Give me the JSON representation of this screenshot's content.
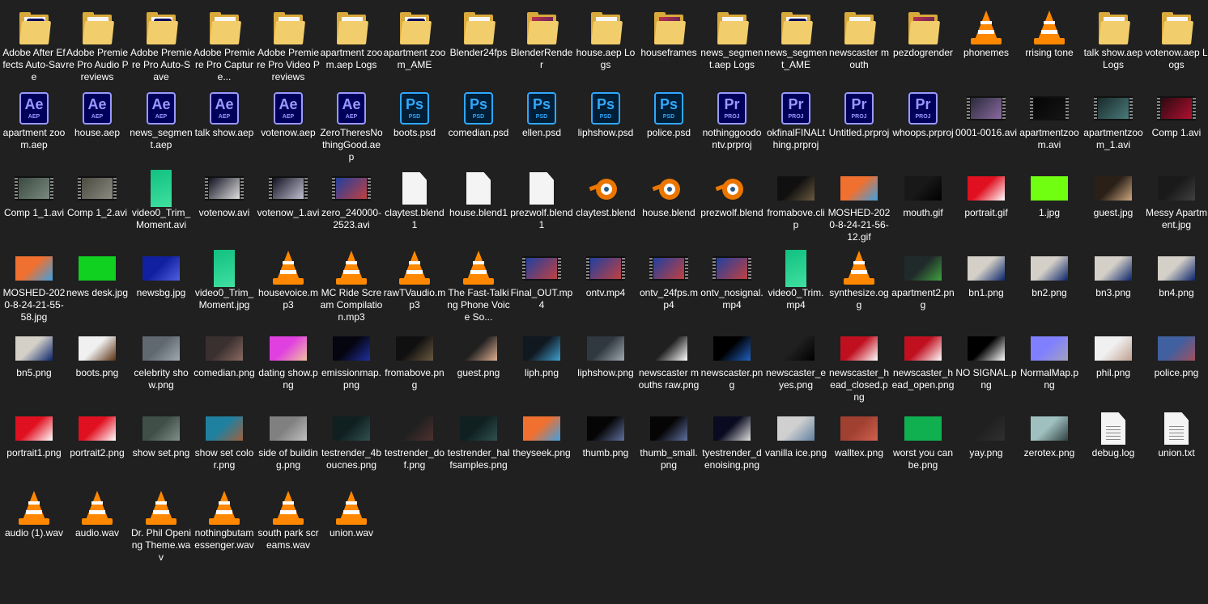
{
  "items": [
    {
      "label": "Adobe After Effects Auto-Save",
      "icon": "folder-ae-icon",
      "kind": "folder",
      "badge": "Ae"
    },
    {
      "label": "Adobe Premiere Pro Audio Previews",
      "icon": "folder-icon",
      "kind": "folder"
    },
    {
      "label": "Adobe Premiere Pro Auto-Save",
      "icon": "folder-pr-icon",
      "kind": "folder",
      "badge": "Pr"
    },
    {
      "label": "Adobe Premiere Pro Capture...",
      "icon": "folder-icon",
      "kind": "folder"
    },
    {
      "label": "Adobe Premiere Pro Video Previews",
      "icon": "folder-icon",
      "kind": "folder"
    },
    {
      "label": "apartment zoom.aep Logs",
      "icon": "folder-icon",
      "kind": "folder"
    },
    {
      "label": "apartment zoom_AME",
      "icon": "folder-ae-icon",
      "kind": "folder",
      "badge": "Ae"
    },
    {
      "label": "Blender24fps",
      "icon": "folder-icon",
      "kind": "folder"
    },
    {
      "label": "BlenderRender",
      "icon": "folder-images-icon",
      "kind": "folder-img"
    },
    {
      "label": "house.aep Logs",
      "icon": "folder-icon",
      "kind": "folder"
    },
    {
      "label": "houseframes",
      "icon": "folder-images-icon",
      "kind": "folder-img"
    },
    {
      "label": "news_segment.aep Logs",
      "icon": "folder-icon",
      "kind": "folder"
    },
    {
      "label": "news_segment_AME",
      "icon": "folder-ae-icon",
      "kind": "folder",
      "badge": "Ae"
    },
    {
      "label": "newscaster mouth",
      "icon": "folder-icon",
      "kind": "folder"
    },
    {
      "label": "pezdogrender",
      "icon": "folder-images-icon",
      "kind": "folder-img"
    },
    {
      "label": "phonemes",
      "icon": "folder-vlc-icon",
      "kind": "vlc"
    },
    {
      "label": "rrising tone",
      "icon": "folder-vlc-icon",
      "kind": "vlc"
    },
    {
      "label": "talk show.aep Logs",
      "icon": "folder-icon",
      "kind": "folder"
    },
    {
      "label": "votenow.aep Logs",
      "icon": "folder-icon",
      "kind": "folder"
    },
    {
      "label": "apartment zoom.aep",
      "icon": "after-effects-file-icon",
      "kind": "ae",
      "ext": "AEP"
    },
    {
      "label": "house.aep",
      "icon": "after-effects-file-icon",
      "kind": "ae",
      "ext": "AEP"
    },
    {
      "label": "news_segment.aep",
      "icon": "after-effects-file-icon",
      "kind": "ae",
      "ext": "AEP"
    },
    {
      "label": "talk show.aep",
      "icon": "after-effects-file-icon",
      "kind": "ae",
      "ext": "AEP"
    },
    {
      "label": "votenow.aep",
      "icon": "after-effects-file-icon",
      "kind": "ae",
      "ext": "AEP"
    },
    {
      "label": "ZeroTheresNothingGood.aep",
      "icon": "after-effects-file-icon",
      "kind": "ae",
      "ext": "AEP"
    },
    {
      "label": "boots.psd",
      "icon": "photoshop-file-icon",
      "kind": "ps",
      "ext": "PSD"
    },
    {
      "label": "comedian.psd",
      "icon": "photoshop-file-icon",
      "kind": "ps",
      "ext": "PSD"
    },
    {
      "label": "ellen.psd",
      "icon": "photoshop-file-icon",
      "kind": "ps",
      "ext": "PSD"
    },
    {
      "label": "liphshow.psd",
      "icon": "photoshop-file-icon",
      "kind": "ps",
      "ext": "PSD"
    },
    {
      "label": "police.psd",
      "icon": "photoshop-file-icon",
      "kind": "ps",
      "ext": "PSD"
    },
    {
      "label": "nothinggoodontv.prproj",
      "icon": "premiere-file-icon",
      "kind": "pr",
      "ext": "PROJ"
    },
    {
      "label": "okfinalFINALthing.prproj",
      "icon": "premiere-file-icon",
      "kind": "pr",
      "ext": "PROJ"
    },
    {
      "label": "Untitled.prproj",
      "icon": "premiere-file-icon",
      "kind": "pr",
      "ext": "PROJ"
    },
    {
      "label": "whoops.prproj",
      "icon": "premiere-file-icon",
      "kind": "pr",
      "ext": "PROJ"
    },
    {
      "label": "0001-0016.avi",
      "icon": "video-thumbnail-icon",
      "kind": "film",
      "c1": "#2a2a3a",
      "c2": "#8a6aa0"
    },
    {
      "label": "apartmentzoom.avi",
      "icon": "video-thumbnail-icon",
      "kind": "film",
      "c1": "#050505",
      "c2": "#151515"
    },
    {
      "label": "apartmentzoom_1.avi",
      "icon": "video-thumbnail-icon",
      "kind": "film",
      "c1": "#1a2a2a",
      "c2": "#4a7a7a"
    },
    {
      "label": "Comp 1.avi",
      "icon": "video-thumbnail-icon",
      "kind": "film",
      "c1": "#2a0a10",
      "c2": "#b01030"
    },
    {
      "label": "Comp 1_1.avi",
      "icon": "video-thumbnail-icon",
      "kind": "film",
      "c1": "#3a4a40",
      "c2": "#7a8a80"
    },
    {
      "label": "Comp 1_2.avi",
      "icon": "video-thumbnail-icon",
      "kind": "film",
      "c1": "#4a4a40",
      "c2": "#8a8a80"
    },
    {
      "label": "video0_Trim_Moment.avi",
      "icon": "video-thumbnail-icon",
      "kind": "tall",
      "c1": "#10c080",
      "c2": "#40e0a0"
    },
    {
      "label": "votenow.avi",
      "icon": "video-thumbnail-icon",
      "kind": "film",
      "c1": "#101020",
      "c2": "#e0e0e0"
    },
    {
      "label": "votenow_1.avi",
      "icon": "video-thumbnail-icon",
      "kind": "film",
      "c1": "#101020",
      "c2": "#c0c0d0"
    },
    {
      "label": "zero_240000-2523.avi",
      "icon": "video-thumbnail-icon",
      "kind": "film",
      "c1": "#2040a0",
      "c2": "#c04040"
    },
    {
      "label": "claytest.blend1",
      "icon": "blank-file-icon",
      "kind": "doc"
    },
    {
      "label": "house.blend1",
      "icon": "blank-file-icon",
      "kind": "doc"
    },
    {
      "label": "prezwolf.blend1",
      "icon": "blank-file-icon",
      "kind": "doc"
    },
    {
      "label": "claytest.blend",
      "icon": "blender-icon",
      "kind": "blender"
    },
    {
      "label": "house.blend",
      "icon": "blender-icon",
      "kind": "blender"
    },
    {
      "label": "prezwolf.blend",
      "icon": "blender-icon",
      "kind": "blender"
    },
    {
      "label": "fromabove.clip",
      "icon": "clip-file-icon",
      "kind": "img",
      "c1": "#101010",
      "c2": "#6a5a40"
    },
    {
      "label": "MOSHED-2020-8-24-21-56-12.gif",
      "icon": "image-thumbnail-icon",
      "kind": "img",
      "c1": "#f07030",
      "c2": "#40a0e0"
    },
    {
      "label": "mouth.gif",
      "icon": "image-thumbnail-icon",
      "kind": "img",
      "c1": "#181818",
      "c2": "#000000"
    },
    {
      "label": "portrait.gif",
      "icon": "image-thumbnail-icon",
      "kind": "img",
      "c1": "#e01020",
      "c2": "#ffffff"
    },
    {
      "label": "1.jpg",
      "icon": "image-thumbnail-icon",
      "kind": "img",
      "c1": "#70ff10",
      "c2": "#70ff10"
    },
    {
      "label": "guest.jpg",
      "icon": "image-thumbnail-icon",
      "kind": "img",
      "c1": "#2a2018",
      "c2": "#d0a880"
    },
    {
      "label": "Messy Apartment.jpg",
      "icon": "image-thumbnail-icon",
      "kind": "img",
      "c1": "#1a1a1a",
      "c2": "#404040"
    },
    {
      "label": "MOSHED-2020-8-24-21-55-58.jpg",
      "icon": "image-thumbnail-icon",
      "kind": "img",
      "c1": "#f07030",
      "c2": "#40a0e0"
    },
    {
      "label": "news desk.jpg",
      "icon": "image-thumbnail-icon",
      "kind": "img",
      "c1": "#10d020",
      "c2": "#10d020"
    },
    {
      "label": "newsbg.jpg",
      "icon": "image-thumbnail-icon",
      "kind": "img",
      "c1": "#1020a0",
      "c2": "#5060e0"
    },
    {
      "label": "video0_Trim_Moment.jpg",
      "icon": "image-thumbnail-icon",
      "kind": "tall",
      "c1": "#10c080",
      "c2": "#40e0a0"
    },
    {
      "label": "housevoice.mp3",
      "icon": "vlc-icon",
      "kind": "vlc"
    },
    {
      "label": "MC Ride Scream Compilation.mp3",
      "icon": "vlc-icon",
      "kind": "vlc"
    },
    {
      "label": "rawTVaudio.mp3",
      "icon": "vlc-icon",
      "kind": "vlc"
    },
    {
      "label": "The Fast-Talking Phone Voice So...",
      "icon": "vlc-icon",
      "kind": "vlc"
    },
    {
      "label": "Final_OUT.mp4",
      "icon": "video-thumbnail-icon",
      "kind": "film",
      "c1": "#2040a0",
      "c2": "#c04040"
    },
    {
      "label": "ontv.mp4",
      "icon": "video-thumbnail-icon",
      "kind": "film",
      "c1": "#2040a0",
      "c2": "#c04040"
    },
    {
      "label": "ontv_24fps.mp4",
      "icon": "video-thumbnail-icon",
      "kind": "film",
      "c1": "#2040a0",
      "c2": "#c04040"
    },
    {
      "label": "ontv_nosignal.mp4",
      "icon": "video-thumbnail-icon",
      "kind": "film",
      "c1": "#2040a0",
      "c2": "#c04040"
    },
    {
      "label": "video0_Trim.mp4",
      "icon": "video-thumbnail-icon",
      "kind": "tall",
      "c1": "#10c080",
      "c2": "#40e0a0"
    },
    {
      "label": "synthesize.ogg",
      "icon": "vlc-icon",
      "kind": "vlc"
    },
    {
      "label": "apartment2.png",
      "icon": "image-thumbnail-icon",
      "kind": "img",
      "c1": "#202a2a",
      "c2": "#40a040"
    },
    {
      "label": "bn1.png",
      "icon": "image-thumbnail-icon",
      "kind": "img",
      "c1": "#d4d0c8",
      "c2": "#0a246a"
    },
    {
      "label": "bn2.png",
      "icon": "image-thumbnail-icon",
      "kind": "img",
      "c1": "#d4d0c8",
      "c2": "#0a246a"
    },
    {
      "label": "bn3.png",
      "icon": "image-thumbnail-icon",
      "kind": "img",
      "c1": "#d4d0c8",
      "c2": "#0a246a"
    },
    {
      "label": "bn4.png",
      "icon": "image-thumbnail-icon",
      "kind": "img",
      "c1": "#d4d0c8",
      "c2": "#0a246a"
    },
    {
      "label": "bn5.png",
      "icon": "image-thumbnail-icon",
      "kind": "img",
      "c1": "#d4d0c8",
      "c2": "#0a246a"
    },
    {
      "label": "boots.png",
      "icon": "image-thumbnail-icon",
      "kind": "img",
      "c1": "#f0f0f0",
      "c2": "#5a3010"
    },
    {
      "label": "celebrity show.png",
      "icon": "image-thumbnail-icon",
      "kind": "img",
      "c1": "#606870",
      "c2": "#a0a8b0"
    },
    {
      "label": "comedian.png",
      "icon": "image-thumbnail-icon",
      "kind": "img",
      "c1": "#3a3030",
      "c2": "#8a6a60"
    },
    {
      "label": "dating show.png",
      "icon": "image-thumbnail-icon",
      "kind": "img",
      "c1": "#e040e0",
      "c2": "#f0c0a0"
    },
    {
      "label": "emissionmap.png",
      "icon": "image-thumbnail-icon",
      "kind": "img",
      "c1": "#050510",
      "c2": "#2030a0"
    },
    {
      "label": "fromabove.png",
      "icon": "image-thumbnail-icon",
      "kind": "img",
      "c1": "#101010",
      "c2": "#6a5a40"
    },
    {
      "label": "guest.png",
      "icon": "image-thumbnail-icon",
      "kind": "img",
      "c1": "#202020",
      "c2": "#e0b090"
    },
    {
      "label": "liph.png",
      "icon": "image-thumbnail-icon",
      "kind": "img",
      "c1": "#101820",
      "c2": "#40a0d0"
    },
    {
      "label": "liphshow.png",
      "icon": "image-thumbnail-icon",
      "kind": "img",
      "c1": "#303840",
      "c2": "#a0a8b0"
    },
    {
      "label": "newscaster mouths raw.png",
      "icon": "image-thumbnail-icon",
      "kind": "img",
      "c1": "#202020",
      "c2": "#ffffff"
    },
    {
      "label": "newscaster.png",
      "icon": "image-thumbnail-icon",
      "kind": "img",
      "c1": "#000000",
      "c2": "#2060c0"
    },
    {
      "label": "newscaster_eyes.png",
      "icon": "image-thumbnail-icon",
      "kind": "img",
      "c1": "#202020",
      "c2": "#000000"
    },
    {
      "label": "newscaster_head_closed.png",
      "icon": "image-thumbnail-icon",
      "kind": "img",
      "c1": "#c01020",
      "c2": "#ffffff"
    },
    {
      "label": "newscaster_head_open.png",
      "icon": "image-thumbnail-icon",
      "kind": "img",
      "c1": "#c01020",
      "c2": "#ffffff"
    },
    {
      "label": "NO SIGNAL.png",
      "icon": "image-thumbnail-icon",
      "kind": "img",
      "c1": "#000000",
      "c2": "#ffffff"
    },
    {
      "label": "NormalMap.png",
      "icon": "image-thumbnail-icon",
      "kind": "img",
      "c1": "#8080ff",
      "c2": "#a0a0c0"
    },
    {
      "label": "phil.png",
      "icon": "image-thumbnail-icon",
      "kind": "img",
      "c1": "#f0f0f0",
      "c2": "#c0a090"
    },
    {
      "label": "police.png",
      "icon": "image-thumbnail-icon",
      "kind": "img",
      "c1": "#4060a0",
      "c2": "#a05060"
    },
    {
      "label": "portrait1.png",
      "icon": "image-thumbnail-icon",
      "kind": "img",
      "c1": "#e01020",
      "c2": "#ffffff"
    },
    {
      "label": "portrait2.png",
      "icon": "image-thumbnail-icon",
      "kind": "img",
      "c1": "#e01020",
      "c2": "#ffffff"
    },
    {
      "label": "show set.png",
      "icon": "image-thumbnail-icon",
      "kind": "img",
      "c1": "#405048",
      "c2": "#809088"
    },
    {
      "label": "show set color.png",
      "icon": "image-thumbnail-icon",
      "kind": "img",
      "c1": "#2080a0",
      "c2": "#a06040"
    },
    {
      "label": "side of building.png",
      "icon": "image-thumbnail-icon",
      "kind": "img",
      "c1": "#808080",
      "c2": "#c0c0c0"
    },
    {
      "label": "testrender_4boucnes.png",
      "icon": "image-thumbnail-icon",
      "kind": "img",
      "c1": "#102020",
      "c2": "#305050"
    },
    {
      "label": "testrender_dof.png",
      "icon": "image-thumbnail-icon",
      "kind": "img",
      "c1": "#202020",
      "c2": "#503030"
    },
    {
      "label": "testrender_halfsamples.png",
      "icon": "image-thumbnail-icon",
      "kind": "img",
      "c1": "#102020",
      "c2": "#305050"
    },
    {
      "label": "theyseek.png",
      "icon": "image-thumbnail-icon",
      "kind": "img",
      "c1": "#f07030",
      "c2": "#40a0e0"
    },
    {
      "label": "thumb.png",
      "icon": "image-thumbnail-icon",
      "kind": "img",
      "c1": "#050505",
      "c2": "#6070a0"
    },
    {
      "label": "thumb_small.png",
      "icon": "image-thumbnail-icon",
      "kind": "img",
      "c1": "#050505",
      "c2": "#6070a0"
    },
    {
      "label": "tyestrender_denoising.png",
      "icon": "image-thumbnail-icon",
      "kind": "img",
      "c1": "#0a0a20",
      "c2": "#e0e0e0"
    },
    {
      "label": "vanilla ice.png",
      "icon": "image-thumbnail-icon",
      "kind": "img",
      "c1": "#d0d0d0",
      "c2": "#6080a0"
    },
    {
      "label": "walltex.png",
      "icon": "image-thumbnail-icon",
      "kind": "img",
      "c1": "#a04030",
      "c2": "#d06050"
    },
    {
      "label": "worst you can be.png",
      "icon": "image-thumbnail-icon",
      "kind": "img",
      "c1": "#10b050",
      "c2": "#10b050"
    },
    {
      "label": "yay.png",
      "icon": "image-thumbnail-icon",
      "kind": "img",
      "c1": "#202020",
      "c2": "#303030"
    },
    {
      "label": "zerotex.png",
      "icon": "image-thumbnail-icon",
      "kind": "img",
      "c1": "#a0c0c0",
      "c2": "#304040"
    },
    {
      "label": "debug.log",
      "icon": "text-document-icon",
      "kind": "txt"
    },
    {
      "label": "union.txt",
      "icon": "text-document-icon",
      "kind": "txt"
    },
    {
      "label": "audio (1).wav",
      "icon": "vlc-icon",
      "kind": "vlc"
    },
    {
      "label": "audio.wav",
      "icon": "vlc-icon",
      "kind": "vlc"
    },
    {
      "label": "Dr. Phil Opening Theme.wav",
      "icon": "vlc-icon",
      "kind": "vlc"
    },
    {
      "label": "nothingbutamessenger.wav",
      "icon": "vlc-icon",
      "kind": "vlc"
    },
    {
      "label": "south park screams.wav",
      "icon": "vlc-icon",
      "kind": "vlc"
    },
    {
      "label": "union.wav",
      "icon": "vlc-icon",
      "kind": "vlc"
    }
  ]
}
